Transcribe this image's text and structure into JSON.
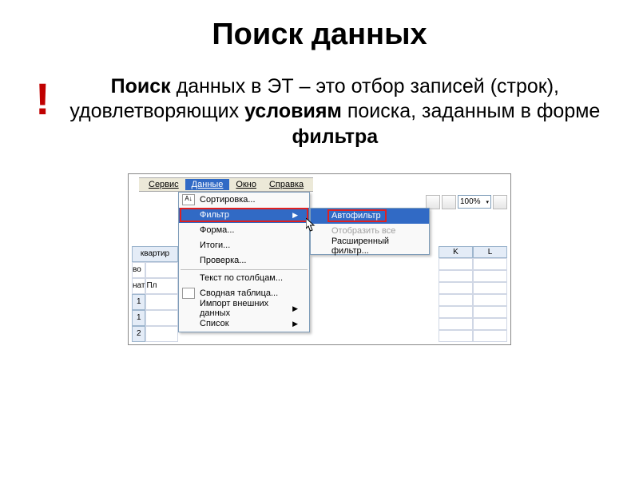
{
  "title": "Поиск данных",
  "exclaim": "!",
  "definition_parts": {
    "p1": "Поиск",
    "p2": " данных в ЭТ – это отбор записей (строк), удовлетворяющих ",
    "p3": "условиям",
    "p4": " поиска, заданным в форме ",
    "p5": "фильтра"
  },
  "menubar": {
    "items": [
      "Сервис",
      "Данные",
      "Окно",
      "Справка"
    ],
    "open_index": 1
  },
  "toolbar": {
    "zoom": "100%"
  },
  "dropdown": {
    "items": [
      {
        "label": "Сортировка...",
        "underline": "С",
        "icon": true
      },
      {
        "label": "Фильтр",
        "underline": "Ф",
        "submenu": true,
        "highlight": true
      },
      {
        "label": "Форма...",
        "underline": "о"
      },
      {
        "label": "Итоги...",
        "underline": "И"
      },
      {
        "label": "Проверка...",
        "underline": "П"
      },
      {
        "sep": true
      },
      {
        "label": "Текст по столбцам...",
        "underline": "Т"
      },
      {
        "label": "Сводная таблица...",
        "underline": "в",
        "icon": true
      },
      {
        "label": "Импорт внешних данных",
        "underline": "И",
        "submenu": true
      },
      {
        "label": "Список",
        "underline": "С",
        "submenu": true
      }
    ]
  },
  "submenu": {
    "items": [
      {
        "label": "Автофильтр",
        "underline": "А",
        "highlight": true
      },
      {
        "label": "Отобразить все",
        "underline": "О",
        "disabled": true
      },
      {
        "label": "Расширенный фильтр...",
        "underline": "Р"
      }
    ]
  },
  "sheet_fragment": {
    "header_cells": [
      "",
      "квартир"
    ],
    "left_label1": "во",
    "left_label2": "нат",
    "left_label3": "Пл",
    "row_numbers": [
      "1",
      "1",
      "2"
    ],
    "right_columns": [
      "K",
      "L"
    ]
  }
}
